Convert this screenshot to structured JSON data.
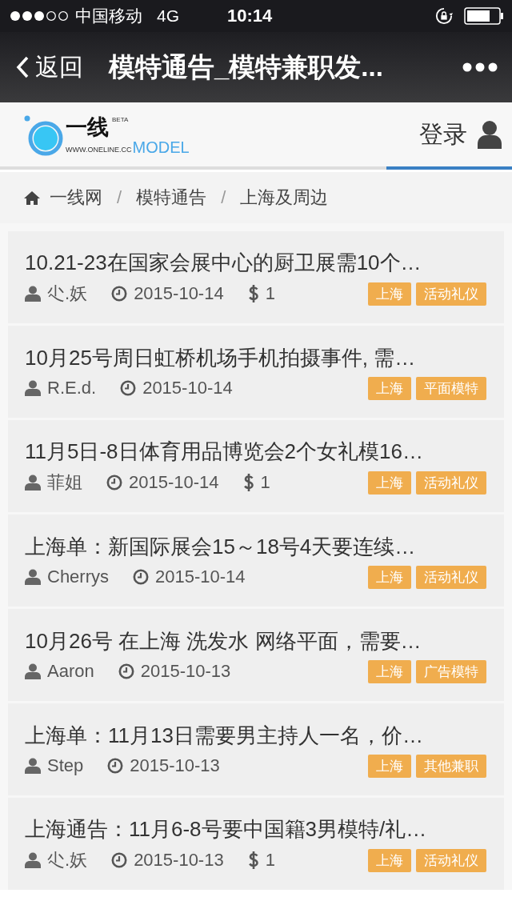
{
  "status_bar": {
    "carrier": "中国移动",
    "network": "4G",
    "time": "10:14"
  },
  "nav_bar": {
    "back": "返回",
    "title": "模特通告_模特兼职发..."
  },
  "header": {
    "logo": {
      "name": "一线",
      "beta": "BETA",
      "url": "WWW.ONELINE.CC",
      "model": "MODEL"
    },
    "login": "登录"
  },
  "breadcrumb": {
    "separator": "/",
    "items": [
      "一线网",
      "模特通告",
      "上海及周边"
    ]
  },
  "posts": [
    {
      "title": "10.21-23在国家会展中心的厨卫展需10个…",
      "author": "尐.妖",
      "date": "2015-10-14",
      "pay": "1",
      "tags": [
        "上海",
        "活动礼仪"
      ]
    },
    {
      "title": "10月25号周日虹桥机场手机拍摄事件, 需…",
      "author": "R.E.d.",
      "date": "2015-10-14",
      "tags": [
        "上海",
        "平面模特"
      ]
    },
    {
      "title": "11月5日-8日体育用品博览会2个女礼模16…",
      "author": "菲姐",
      "date": "2015-10-14",
      "pay": "1",
      "tags": [
        "上海",
        "活动礼仪"
      ]
    },
    {
      "title": "上海单：新国际展会15～18号4天要连续…",
      "author": "Cherrys",
      "date": "2015-10-14",
      "tags": [
        "上海",
        "活动礼仪"
      ]
    },
    {
      "title": "10月26号 在上海 洗发水 网络平面，需要…",
      "author": "Aaron",
      "date": "2015-10-13",
      "tags": [
        "上海",
        "广告模特"
      ]
    },
    {
      "title": "上海单：11月13日需要男主持人一名，价…",
      "author": "Step",
      "date": "2015-10-13",
      "tags": [
        "上海",
        "其他兼职"
      ]
    },
    {
      "title": "上海通告：11月6-8号要中国籍3男模特/礼…",
      "author": "尐.妖",
      "date": "2015-10-13",
      "pay": "1",
      "tags": [
        "上海",
        "活动礼仪"
      ]
    }
  ]
}
